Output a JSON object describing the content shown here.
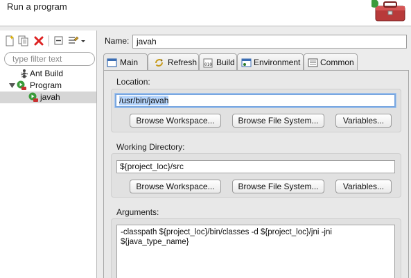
{
  "window": {
    "title": "Run a program"
  },
  "sidebar": {
    "filter_placeholder": "type filter text",
    "toolbar": [
      "new-launch-config-icon",
      "duplicate-icon",
      "delete-icon",
      "collapse-all-icon",
      "filter-icon"
    ],
    "tree": [
      {
        "label": "Ant Build",
        "level": 1,
        "icon": "ant-icon"
      },
      {
        "label": "Program",
        "level": 0,
        "expanded": true,
        "icon": "program-icon"
      },
      {
        "label": "javah",
        "level": 1,
        "selected": true,
        "icon": "external-tool-icon"
      }
    ]
  },
  "config": {
    "name_label": "Name:",
    "name_value": "javah"
  },
  "tabs": [
    {
      "label": "Main",
      "icon": "main-tab-icon",
      "active": true
    },
    {
      "label": "Refresh",
      "icon": "refresh-icon"
    },
    {
      "label": "Build",
      "icon": "build-icon"
    },
    {
      "label": "Environment",
      "icon": "environment-icon"
    },
    {
      "label": "Common",
      "icon": "common-icon"
    }
  ],
  "main": {
    "location": {
      "label": "Location:",
      "value": "/usr/bin/javah",
      "browse_workspace": "Browse Workspace...",
      "browse_file_system": "Browse File System...",
      "variables": "Variables..."
    },
    "working_directory": {
      "label": "Working Directory:",
      "value": "${project_loc}/src",
      "browse_workspace": "Browse Workspace...",
      "browse_file_system": "Browse File System...",
      "variables": "Variables..."
    },
    "arguments": {
      "label": "Arguments:",
      "value": "-classpath ${project_loc}/bin/classes -d ${project_loc}/jni -jni ${java_type_name}"
    }
  }
}
